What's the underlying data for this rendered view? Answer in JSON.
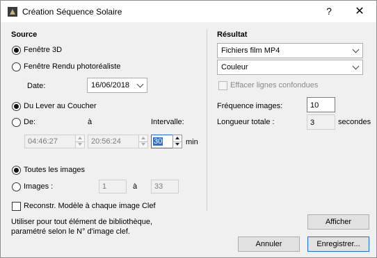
{
  "window": {
    "title": "Création Séquence Solaire",
    "help_glyph": "?",
    "close_glyph": "✕"
  },
  "source": {
    "heading": "Source",
    "view_options": [
      {
        "label": "Fenêtre 3D",
        "selected": true
      },
      {
        "label": "Fenêtre Rendu photoréaliste",
        "selected": false
      }
    ],
    "date_label": "Date:",
    "date_value": "16/06/2018",
    "time_options": [
      {
        "label": "Du Lever au Coucher",
        "selected": true
      },
      {
        "label": "De:",
        "selected": false
      }
    ],
    "to_label": "à",
    "interval_label": "Intervalle:",
    "from_time": "04:46:27",
    "to_time": "20:56:24",
    "interval_value": "30",
    "interval_unit": "min",
    "image_options": [
      {
        "label": "Toutes les images",
        "selected": true
      },
      {
        "label": "Images :",
        "selected": false
      }
    ],
    "images_from": "1",
    "images_to_label": "à",
    "images_to": "33",
    "rebuild_label": "Reconstr. Modèle à chaque image Clef",
    "rebuild_checked": false,
    "note_line1": "Utiliser pour tout élément de bibliothèque,",
    "note_line2": "paramétré selon le N° d'image clef."
  },
  "result": {
    "heading": "Résultat",
    "format_value": "Fichiers film MP4",
    "color_value": "Couleur",
    "erase_lines_label": "Effacer lignes confondues",
    "erase_lines_checked": false,
    "frequency_label": "Fréquence images:",
    "frequency_value": "10",
    "duration_label": "Longueur totale :",
    "duration_value": "3",
    "duration_unit": "secondes"
  },
  "buttons": {
    "show": "Afficher",
    "cancel": "Annuler",
    "save": "Enregistrer..."
  }
}
